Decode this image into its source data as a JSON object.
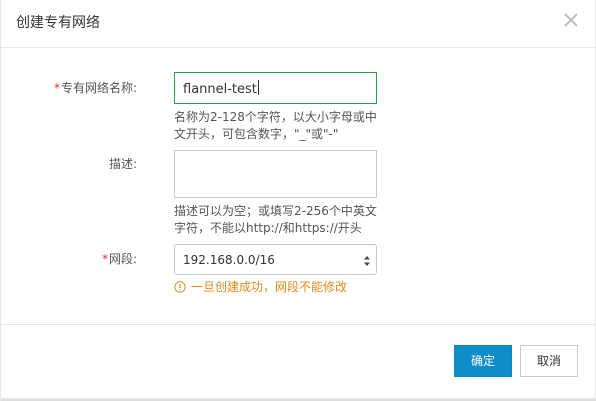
{
  "dialog": {
    "title": "创建专有网络",
    "close_icon": "close-icon"
  },
  "form": {
    "name": {
      "required_mark": "*",
      "label": "专有网络名称:",
      "value": "flannel-test",
      "hint": "名称为2-128个字符，以大小字母或中文开头，可包含数字，\"_\"或\"-\""
    },
    "description": {
      "label": "描述:",
      "value": "",
      "hint": "描述可以为空；或填写2-256个中英文字符，不能以http://和https://开头"
    },
    "segment": {
      "required_mark": "*",
      "label": "网段:",
      "selected": "192.168.0.0/16",
      "warning": "一旦创建成功，网段不能修改"
    }
  },
  "buttons": {
    "confirm": "确定",
    "cancel": "取消"
  },
  "colors": {
    "primary": "#0e8ec9",
    "warning": "#e08a1e",
    "required": "#e0301e",
    "focus_border": "#2aa148"
  }
}
